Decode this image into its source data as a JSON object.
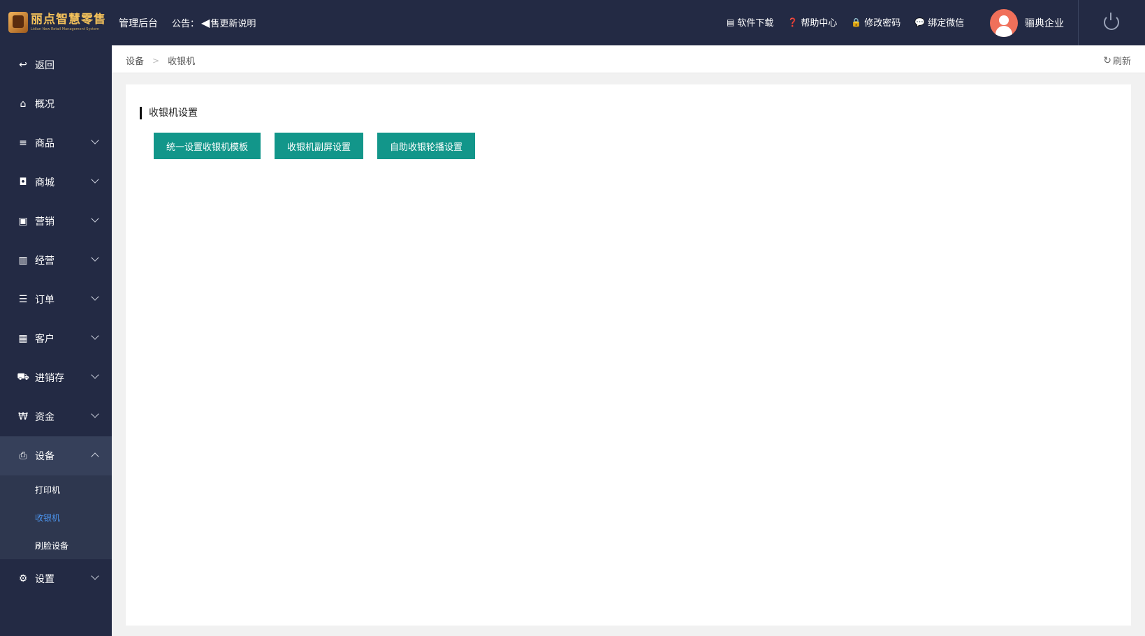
{
  "app": {
    "logo_cn": "丽点智慧零售",
    "logo_en": "Lidian New Retail Management System",
    "admin_label": "管理后台",
    "notice_label": "公告：",
    "notice_text": "售更新说明"
  },
  "header": {
    "links": [
      {
        "icon": "shop-icon",
        "label": "软件下载"
      },
      {
        "icon": "help-icon",
        "label": "帮助中心"
      },
      {
        "icon": "key-icon",
        "label": "修改密码"
      },
      {
        "icon": "wechat-icon",
        "label": "绑定微信"
      }
    ],
    "user_name": "骊典企业",
    "avatar_color": "#f0705a"
  },
  "sidebar": {
    "items": [
      {
        "icon": "back-icon",
        "label": "返回"
      },
      {
        "icon": "home-icon",
        "label": "概况"
      },
      {
        "icon": "list-icon",
        "label": "商品"
      },
      {
        "icon": "bag-icon",
        "label": "商城"
      },
      {
        "icon": "gift-icon",
        "label": "营销"
      },
      {
        "icon": "bar-chart-icon",
        "label": "经营"
      },
      {
        "icon": "order-list-icon",
        "label": "订单"
      },
      {
        "icon": "id-card-icon",
        "label": "客户"
      },
      {
        "icon": "truck-icon",
        "label": "进销存"
      },
      {
        "icon": "won-icon",
        "label": "资金"
      },
      {
        "icon": "printer-icon",
        "label": "设备"
      },
      {
        "icon": "gear-icon",
        "label": "设置"
      }
    ],
    "device_sub": [
      "打印机",
      "收银机",
      "刷脸设备"
    ],
    "active_sub": "收银机"
  },
  "breadcrumb": {
    "parent": "设备",
    "current": "收银机",
    "refresh_label": "刷新"
  },
  "main": {
    "section_title": "收银机设置",
    "buttons": [
      "统一设置收银机模板",
      "收银机副屏设置",
      "自助收银轮播设置"
    ]
  },
  "colors": {
    "sidebar_bg": "#232a44",
    "primary_button": "#12968a",
    "active_link": "#4b91e8"
  }
}
